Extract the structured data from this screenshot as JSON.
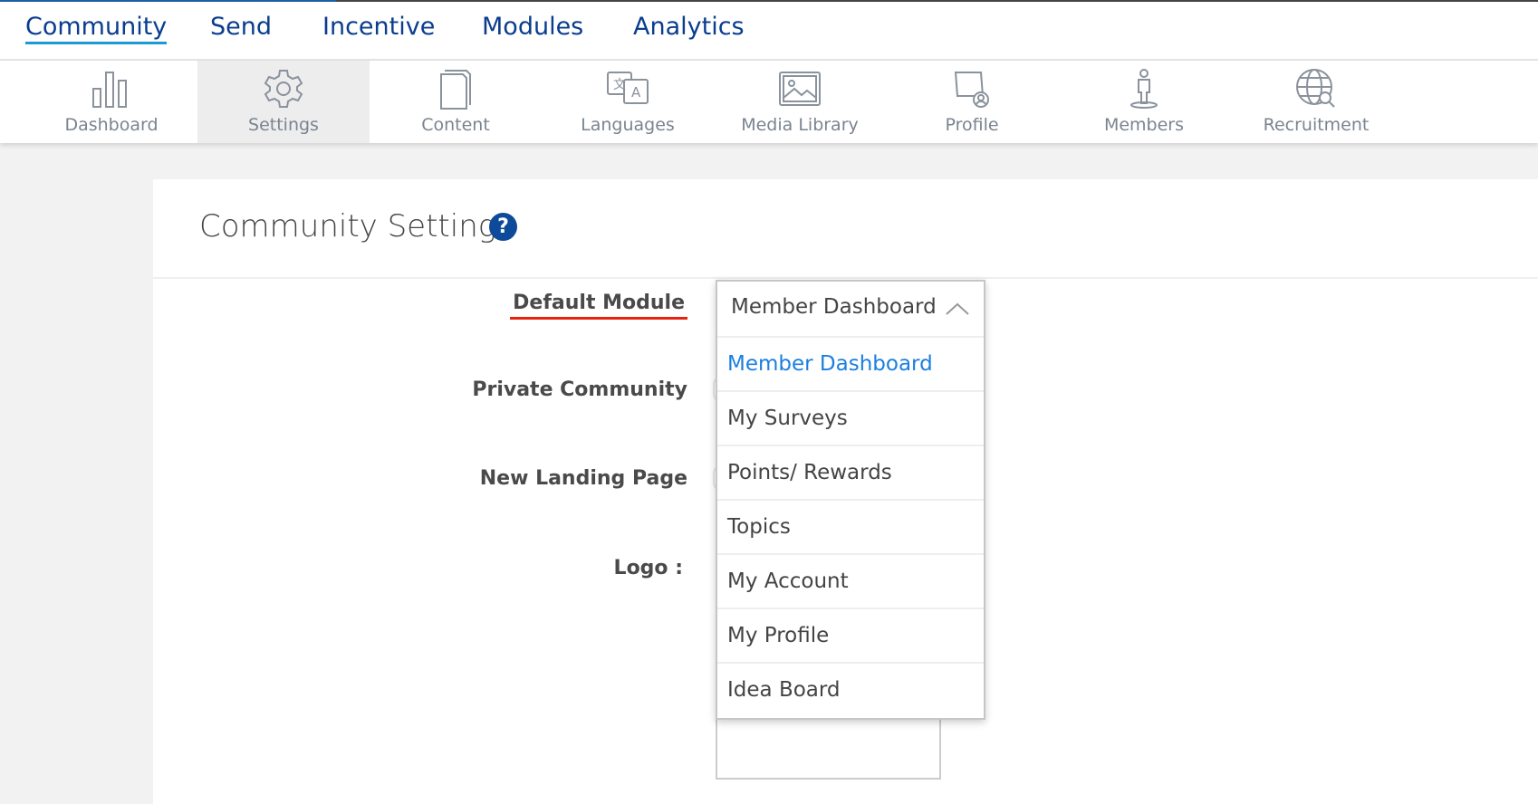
{
  "main_nav": {
    "tabs": [
      {
        "label": "Community",
        "active": true
      },
      {
        "label": "Send"
      },
      {
        "label": "Incentive"
      },
      {
        "label": "Modules"
      },
      {
        "label": "Analytics"
      }
    ]
  },
  "toolbar": {
    "items": [
      {
        "label": "Dashboard",
        "icon": "bar-chart-icon"
      },
      {
        "label": "Settings",
        "icon": "gear-icon",
        "active": true
      },
      {
        "label": "Content",
        "icon": "document-icon"
      },
      {
        "label": "Languages",
        "icon": "translate-icon"
      },
      {
        "label": "Media Library",
        "icon": "image-icon"
      },
      {
        "label": "Profile",
        "icon": "profile-icon"
      },
      {
        "label": "Members",
        "icon": "person-icon"
      },
      {
        "label": "Recruitment",
        "icon": "globe-search-icon"
      }
    ]
  },
  "page": {
    "title": "Community Setting",
    "help": "?"
  },
  "form": {
    "default_module_label": "Default Module",
    "private_community_label": "Private Community",
    "new_landing_page_label": "New Landing Page",
    "logo_label": "Logo :"
  },
  "dropdown": {
    "selected": "Member Dashboard",
    "options": [
      "Member Dashboard",
      "My Surveys",
      "Points/ Rewards",
      "Topics",
      "My Account",
      "My Profile",
      "Idea Board"
    ]
  },
  "colors": {
    "nav_text": "#0a3d8f",
    "accent": "#1a9ad6",
    "selected_option": "#1a7fe0",
    "label_underline": "#e8220f"
  }
}
